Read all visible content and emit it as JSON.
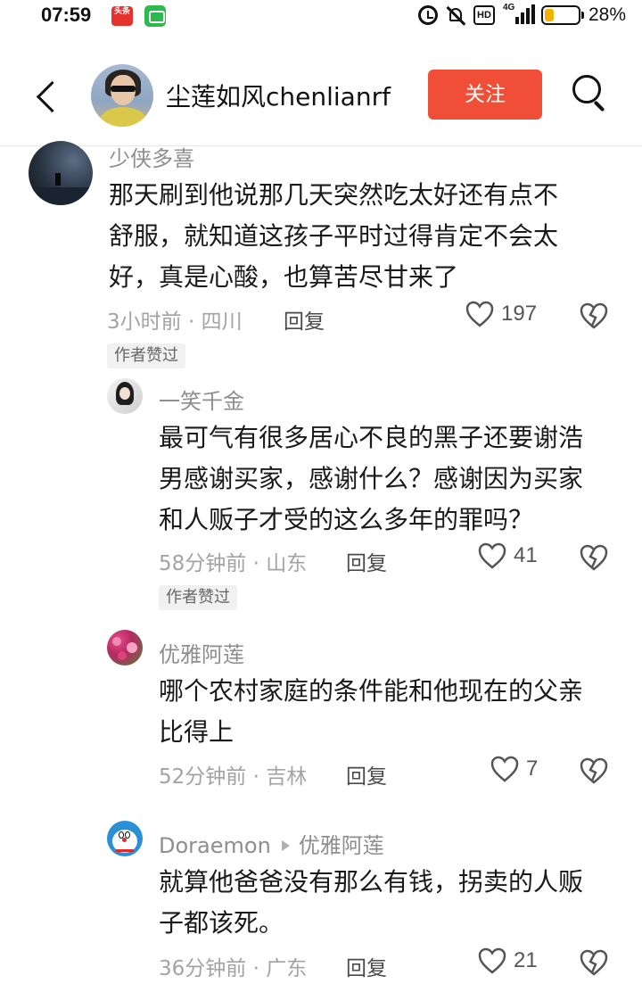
{
  "status_bar": {
    "time": "07:59",
    "app_badge_1": "头条",
    "hd": "HD",
    "network": "4G",
    "battery_percent": "28%",
    "battery_level": 0.28
  },
  "header": {
    "name": "尘莲如风chenlianrf",
    "follow_label": "关注"
  },
  "comments": [
    {
      "author": "少侠多喜",
      "lines": [
        "那天刷到他说那几天突然吃太好还有点不",
        "舒服，就知道这孩子平时过得肯定不会太",
        "好，真是心酸，也算苦尽甘来了"
      ],
      "meta": "3小时前 · 四川",
      "reply": "回复",
      "likes": "197",
      "badge": "作者赞过"
    },
    {
      "author": "一笑千金",
      "lines": [
        "最可气有很多居心不良的黑子还要谢浩",
        "男感谢买家，感谢什么？感谢因为买家",
        "和人贩子才受的这么多年的罪吗？"
      ],
      "meta": "58分钟前 · 山东",
      "reply": "回复",
      "likes": "41",
      "badge": "作者赞过"
    },
    {
      "author": "优雅阿莲",
      "lines": [
        "哪个农村家庭的条件能和他现在的父亲",
        "比得上"
      ],
      "meta": "52分钟前 · 吉林",
      "reply": "回复",
      "likes": "7"
    },
    {
      "author": "Doraemon",
      "reply_to": "优雅阿莲",
      "lines": [
        "就算他爸爸没有那么有钱，拐卖的人贩",
        "子都该死。"
      ],
      "meta": "36分钟前 · 广东",
      "reply": "回复",
      "likes": "21"
    }
  ],
  "colors": {
    "accent": "#f04e37",
    "battery": "#f2b200",
    "text": "#1a1a1a",
    "muted": "#a3a3a3"
  },
  "icons": [
    "back-arrow-icon",
    "search-icon",
    "heart-icon",
    "broken-heart-icon",
    "alarm-icon",
    "mute-icon",
    "battery-icon"
  ]
}
